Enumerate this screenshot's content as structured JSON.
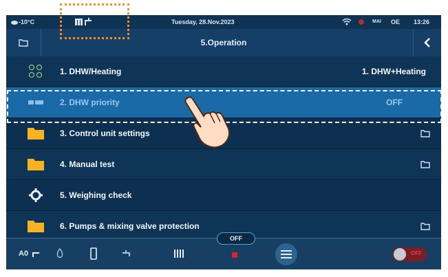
{
  "status": {
    "temperature": "-10°C",
    "date": "Tuesday, 28.Nov.2023",
    "time": "13:26",
    "language": "OE",
    "signal_label": "MAI"
  },
  "header": {
    "title": "5.Operation"
  },
  "rows": [
    {
      "label": "1. DHW/Heating",
      "value": "1. DHW+Heating",
      "icon": "mode-dots-icon"
    },
    {
      "label": "2. DHW priority",
      "value": "OFF",
      "icon": "dhw-priority-icon"
    },
    {
      "label": "3. Control unit settings",
      "value": "",
      "icon": "folder-icon"
    },
    {
      "label": "4. Manual test",
      "value": "",
      "icon": "folder-icon"
    },
    {
      "label": "5. Weighing check",
      "value": "",
      "icon": "gear-icon"
    },
    {
      "label": "6. Pumps & mixing valve protection",
      "value": "",
      "icon": "folder-icon"
    }
  ],
  "bottom": {
    "off_label": "OFF",
    "toggle_label": "OFF",
    "mode_label": "A0"
  },
  "colors": {
    "background": "#0d2a44",
    "selected_row": "#1a6aa8",
    "highlight_box": "#ff8c1a",
    "folder": "#f5b324"
  }
}
